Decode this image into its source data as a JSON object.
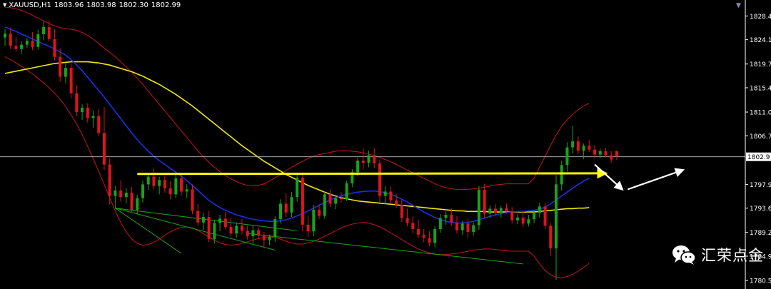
{
  "header": {
    "symbol_timeframe": "XAUUSD,H1",
    "open": "1803.96",
    "high": "1803.98",
    "low": "1802.30",
    "close": "1802.99"
  },
  "price_scale": {
    "labels": [
      "1828.4",
      "1824.1",
      "1819.7",
      "1815.4",
      "1811.0",
      "1806.7",
      "1802.9",
      "1797.9",
      "1793.6",
      "1789.2",
      "1784.9",
      "1780.5"
    ],
    "current_price_label": "1802.9",
    "current_price": 1802.9
  },
  "watermark": {
    "text": "汇荣点金",
    "icon": "wechat-icon"
  },
  "colors": {
    "background": "#000000",
    "bull_candle": "#19a319",
    "bear_candle": "#e0141b",
    "ma_fast": "#1432e6",
    "ma_slow": "#f0e614",
    "bollinger": "#c8141e",
    "trendline": "#1fa51f",
    "projection_arrow": "#ffff00",
    "forecast_arrow": "#ffffff",
    "price_line": "#c0c0c0"
  },
  "chart_data": {
    "type": "candlestick",
    "title": "XAUUSD,H1",
    "ylim": [
      1779.6,
      1830.0
    ],
    "candles": [
      {
        "o": 1824.5,
        "h": 1826.0,
        "l": 1823.0,
        "c": 1825.2
      },
      {
        "o": 1825.2,
        "h": 1826.3,
        "l": 1822.4,
        "c": 1823.0
      },
      {
        "o": 1823.0,
        "h": 1824.6,
        "l": 1821.9,
        "c": 1822.4
      },
      {
        "o": 1822.4,
        "h": 1823.8,
        "l": 1821.5,
        "c": 1823.2
      },
      {
        "o": 1823.2,
        "h": 1824.4,
        "l": 1822.6,
        "c": 1823.9
      },
      {
        "o": 1823.9,
        "h": 1825.5,
        "l": 1822.2,
        "c": 1822.8
      },
      {
        "o": 1822.8,
        "h": 1825.9,
        "l": 1822.3,
        "c": 1825.1
      },
      {
        "o": 1825.1,
        "h": 1827.4,
        "l": 1824.0,
        "c": 1826.4
      },
      {
        "o": 1826.4,
        "h": 1827.6,
        "l": 1823.8,
        "c": 1824.2
      },
      {
        "o": 1824.2,
        "h": 1826.0,
        "l": 1820.4,
        "c": 1821.0
      },
      {
        "o": 1821.0,
        "h": 1822.5,
        "l": 1816.5,
        "c": 1817.4
      },
      {
        "o": 1817.4,
        "h": 1819.8,
        "l": 1816.2,
        "c": 1819.0
      },
      {
        "o": 1819.0,
        "h": 1819.8,
        "l": 1813.5,
        "c": 1814.4
      },
      {
        "o": 1814.4,
        "h": 1815.9,
        "l": 1810.2,
        "c": 1811.0
      },
      {
        "o": 1811.0,
        "h": 1812.4,
        "l": 1809.6,
        "c": 1811.8
      },
      {
        "o": 1811.8,
        "h": 1812.6,
        "l": 1809.1,
        "c": 1809.9
      },
      {
        "o": 1809.9,
        "h": 1811.3,
        "l": 1808.1,
        "c": 1810.3
      },
      {
        "o": 1810.3,
        "h": 1811.5,
        "l": 1806.6,
        "c": 1807.2
      },
      {
        "o": 1807.2,
        "h": 1811.9,
        "l": 1800.5,
        "c": 1801.5
      },
      {
        "o": 1801.5,
        "h": 1802.6,
        "l": 1794.3,
        "c": 1795.8
      },
      {
        "o": 1795.8,
        "h": 1797.6,
        "l": 1793.6,
        "c": 1796.8
      },
      {
        "o": 1796.8,
        "h": 1798.6,
        "l": 1794.8,
        "c": 1795.6
      },
      {
        "o": 1795.6,
        "h": 1797.2,
        "l": 1794.5,
        "c": 1796.4
      },
      {
        "o": 1796.4,
        "h": 1797.4,
        "l": 1792.7,
        "c": 1793.3
      },
      {
        "o": 1793.3,
        "h": 1796.0,
        "l": 1792.6,
        "c": 1795.4
      },
      {
        "o": 1795.4,
        "h": 1798.6,
        "l": 1794.6,
        "c": 1797.9
      },
      {
        "o": 1797.9,
        "h": 1800.0,
        "l": 1796.9,
        "c": 1799.3
      },
      {
        "o": 1799.3,
        "h": 1800.8,
        "l": 1797.0,
        "c": 1797.6
      },
      {
        "o": 1797.6,
        "h": 1799.3,
        "l": 1796.1,
        "c": 1798.7
      },
      {
        "o": 1798.7,
        "h": 1799.4,
        "l": 1796.4,
        "c": 1797.2
      },
      {
        "o": 1797.2,
        "h": 1798.5,
        "l": 1795.2,
        "c": 1796.1
      },
      {
        "o": 1796.1,
        "h": 1799.8,
        "l": 1795.4,
        "c": 1799.0
      },
      {
        "o": 1799.0,
        "h": 1799.9,
        "l": 1795.9,
        "c": 1796.6
      },
      {
        "o": 1796.6,
        "h": 1797.9,
        "l": 1795.4,
        "c": 1797.0
      },
      {
        "o": 1797.0,
        "h": 1797.9,
        "l": 1792.5,
        "c": 1793.1
      },
      {
        "o": 1793.1,
        "h": 1794.3,
        "l": 1790.4,
        "c": 1791.0
      },
      {
        "o": 1791.0,
        "h": 1792.8,
        "l": 1789.6,
        "c": 1792.0
      },
      {
        "o": 1792.0,
        "h": 1793.1,
        "l": 1787.4,
        "c": 1788.0
      },
      {
        "o": 1788.0,
        "h": 1791.5,
        "l": 1787.2,
        "c": 1790.9
      },
      {
        "o": 1790.9,
        "h": 1792.4,
        "l": 1789.4,
        "c": 1791.7
      },
      {
        "o": 1791.7,
        "h": 1792.9,
        "l": 1789.8,
        "c": 1790.2
      },
      {
        "o": 1790.2,
        "h": 1791.8,
        "l": 1788.4,
        "c": 1789.0
      },
      {
        "o": 1789.0,
        "h": 1791.0,
        "l": 1788.2,
        "c": 1790.4
      },
      {
        "o": 1790.4,
        "h": 1791.6,
        "l": 1788.8,
        "c": 1789.5
      },
      {
        "o": 1789.5,
        "h": 1790.4,
        "l": 1787.9,
        "c": 1788.5
      },
      {
        "o": 1788.5,
        "h": 1790.4,
        "l": 1787.2,
        "c": 1789.6
      },
      {
        "o": 1789.6,
        "h": 1790.2,
        "l": 1788.0,
        "c": 1788.6
      },
      {
        "o": 1788.6,
        "h": 1789.3,
        "l": 1786.4,
        "c": 1787.8
      },
      {
        "o": 1787.8,
        "h": 1788.8,
        "l": 1786.9,
        "c": 1788.4
      },
      {
        "o": 1788.4,
        "h": 1792.1,
        "l": 1787.5,
        "c": 1791.6
      },
      {
        "o": 1791.6,
        "h": 1795.2,
        "l": 1790.8,
        "c": 1794.4
      },
      {
        "o": 1794.4,
        "h": 1796.3,
        "l": 1792.0,
        "c": 1792.8
      },
      {
        "o": 1792.8,
        "h": 1796.5,
        "l": 1792.0,
        "c": 1795.6
      },
      {
        "o": 1795.6,
        "h": 1799.9,
        "l": 1794.8,
        "c": 1799.1
      },
      {
        "o": 1799.1,
        "h": 1800.1,
        "l": 1789.4,
        "c": 1790.6
      },
      {
        "o": 1790.6,
        "h": 1792.2,
        "l": 1788.4,
        "c": 1789.4
      },
      {
        "o": 1789.4,
        "h": 1794.2,
        "l": 1788.5,
        "c": 1793.3
      },
      {
        "o": 1793.3,
        "h": 1794.3,
        "l": 1791.6,
        "c": 1792.2
      },
      {
        "o": 1792.2,
        "h": 1796.6,
        "l": 1791.7,
        "c": 1796.1
      },
      {
        "o": 1796.1,
        "h": 1797.0,
        "l": 1793.8,
        "c": 1794.4
      },
      {
        "o": 1794.4,
        "h": 1796.0,
        "l": 1793.4,
        "c": 1795.4
      },
      {
        "o": 1795.4,
        "h": 1796.5,
        "l": 1794.6,
        "c": 1795.2
      },
      {
        "o": 1795.2,
        "h": 1798.6,
        "l": 1794.9,
        "c": 1798.1
      },
      {
        "o": 1798.1,
        "h": 1800.7,
        "l": 1797.4,
        "c": 1800.1
      },
      {
        "o": 1800.1,
        "h": 1802.7,
        "l": 1799.4,
        "c": 1802.2
      },
      {
        "o": 1802.2,
        "h": 1804.4,
        "l": 1800.6,
        "c": 1801.8
      },
      {
        "o": 1801.8,
        "h": 1804.0,
        "l": 1801.0,
        "c": 1803.2
      },
      {
        "o": 1803.2,
        "h": 1804.5,
        "l": 1800.8,
        "c": 1801.7
      },
      {
        "o": 1801.7,
        "h": 1802.4,
        "l": 1794.7,
        "c": 1795.8
      },
      {
        "o": 1795.8,
        "h": 1797.6,
        "l": 1794.4,
        "c": 1796.6
      },
      {
        "o": 1796.6,
        "h": 1797.5,
        "l": 1794.3,
        "c": 1795.0
      },
      {
        "o": 1795.0,
        "h": 1796.2,
        "l": 1793.6,
        "c": 1794.2
      },
      {
        "o": 1794.2,
        "h": 1795.3,
        "l": 1791.1,
        "c": 1791.8
      },
      {
        "o": 1791.8,
        "h": 1793.5,
        "l": 1790.3,
        "c": 1790.9
      },
      {
        "o": 1790.9,
        "h": 1792.1,
        "l": 1789.0,
        "c": 1789.8
      },
      {
        "o": 1789.8,
        "h": 1791.5,
        "l": 1788.2,
        "c": 1788.8
      },
      {
        "o": 1788.8,
        "h": 1789.8,
        "l": 1787.4,
        "c": 1788.2
      },
      {
        "o": 1788.2,
        "h": 1789.4,
        "l": 1786.7,
        "c": 1787.3
      },
      {
        "o": 1787.3,
        "h": 1790.3,
        "l": 1786.5,
        "c": 1789.8
      },
      {
        "o": 1789.8,
        "h": 1792.5,
        "l": 1789.1,
        "c": 1791.8
      },
      {
        "o": 1791.8,
        "h": 1793.0,
        "l": 1790.6,
        "c": 1792.4
      },
      {
        "o": 1792.4,
        "h": 1793.6,
        "l": 1790.4,
        "c": 1791.0
      },
      {
        "o": 1791.0,
        "h": 1792.2,
        "l": 1789.0,
        "c": 1789.6
      },
      {
        "o": 1789.6,
        "h": 1791.3,
        "l": 1788.7,
        "c": 1790.8
      },
      {
        "o": 1790.8,
        "h": 1791.7,
        "l": 1788.2,
        "c": 1789.3
      },
      {
        "o": 1789.3,
        "h": 1791.0,
        "l": 1788.6,
        "c": 1790.5
      },
      {
        "o": 1790.5,
        "h": 1797.6,
        "l": 1789.7,
        "c": 1796.9
      },
      {
        "o": 1796.9,
        "h": 1798.0,
        "l": 1791.8,
        "c": 1792.6
      },
      {
        "o": 1792.6,
        "h": 1794.1,
        "l": 1791.9,
        "c": 1793.5
      },
      {
        "o": 1793.5,
        "h": 1794.3,
        "l": 1792.2,
        "c": 1792.8
      },
      {
        "o": 1792.8,
        "h": 1794.0,
        "l": 1791.9,
        "c": 1793.6
      },
      {
        "o": 1793.6,
        "h": 1794.4,
        "l": 1792.6,
        "c": 1793.0
      },
      {
        "o": 1793.0,
        "h": 1793.8,
        "l": 1790.8,
        "c": 1791.4
      },
      {
        "o": 1791.4,
        "h": 1792.5,
        "l": 1790.7,
        "c": 1791.9
      },
      {
        "o": 1791.9,
        "h": 1793.1,
        "l": 1790.2,
        "c": 1790.8
      },
      {
        "o": 1790.8,
        "h": 1792.4,
        "l": 1790.3,
        "c": 1791.6
      },
      {
        "o": 1791.6,
        "h": 1793.3,
        "l": 1790.9,
        "c": 1792.7
      },
      {
        "o": 1792.7,
        "h": 1794.6,
        "l": 1791.9,
        "c": 1793.9
      },
      {
        "o": 1793.9,
        "h": 1794.5,
        "l": 1789.8,
        "c": 1790.4
      },
      {
        "o": 1790.4,
        "h": 1790.9,
        "l": 1785.0,
        "c": 1786.3
      },
      {
        "o": 1786.3,
        "h": 1799.6,
        "l": 1780.6,
        "c": 1797.9
      },
      {
        "o": 1797.9,
        "h": 1802.2,
        "l": 1796.8,
        "c": 1801.4
      },
      {
        "o": 1801.4,
        "h": 1805.5,
        "l": 1800.2,
        "c": 1804.6
      },
      {
        "o": 1804.6,
        "h": 1808.5,
        "l": 1803.5,
        "c": 1805.7
      },
      {
        "o": 1805.7,
        "h": 1806.6,
        "l": 1803.4,
        "c": 1804.0
      },
      {
        "o": 1804.0,
        "h": 1805.3,
        "l": 1802.5,
        "c": 1804.9
      },
      {
        "o": 1804.9,
        "h": 1805.9,
        "l": 1803.8,
        "c": 1804.2
      },
      {
        "o": 1804.2,
        "h": 1805.0,
        "l": 1802.6,
        "c": 1803.3
      },
      {
        "o": 1803.3,
        "h": 1804.4,
        "l": 1802.7,
        "c": 1803.9
      },
      {
        "o": 1803.9,
        "h": 1804.5,
        "l": 1802.8,
        "c": 1803.2
      },
      {
        "o": 1803.2,
        "h": 1803.9,
        "l": 1801.8,
        "c": 1802.4
      },
      {
        "o": 1803.96,
        "h": 1803.98,
        "l": 1802.3,
        "c": 1802.99
      }
    ],
    "ma_fast": [
      1826.4,
      1826.0,
      1825.6,
      1825.1,
      1824.7,
      1824.2,
      1823.8,
      1823.3,
      1822.9,
      1822.4,
      1821.9,
      1821.3,
      1820.5,
      1819.5,
      1818.5,
      1817.3,
      1816.1,
      1814.9,
      1813.7,
      1812.4,
      1811.1,
      1809.8,
      1808.5,
      1807.2,
      1806.0,
      1804.9,
      1803.9,
      1803.0,
      1802.2,
      1801.5,
      1800.8,
      1800.1,
      1799.4,
      1798.6,
      1797.7,
      1796.8,
      1795.9,
      1795.0,
      1794.3,
      1793.7,
      1793.2,
      1792.8,
      1792.4,
      1792.1,
      1791.8,
      1791.6,
      1791.4,
      1791.3,
      1791.2,
      1791.2,
      1791.3,
      1791.5,
      1791.8,
      1792.2,
      1792.6,
      1793.1,
      1793.6,
      1794.1,
      1794.6,
      1795.1,
      1795.5,
      1795.8,
      1796.1,
      1796.3,
      1796.5,
      1796.6,
      1796.7,
      1796.7,
      1796.6,
      1796.4,
      1796.1,
      1795.7,
      1795.2,
      1794.7,
      1794.1,
      1793.5,
      1792.9,
      1792.4,
      1791.9,
      1791.5,
      1791.2,
      1791.0,
      1790.9,
      1790.9,
      1791.0,
      1791.2,
      1791.5,
      1791.8,
      1792.1,
      1792.4,
      1792.6,
      1792.8,
      1792.9,
      1793.0,
      1793.0,
      1793.1,
      1793.2,
      1793.4,
      1793.8,
      1794.4,
      1795.1,
      1795.8,
      1796.5,
      1797.2,
      1797.9,
      1798.5,
      1799.0
    ],
    "ma_slow": [
      1818.0,
      1818.2,
      1818.4,
      1818.6,
      1818.8,
      1819.0,
      1819.2,
      1819.4,
      1819.6,
      1819.8,
      1819.9,
      1820.0,
      1820.1,
      1820.1,
      1820.1,
      1820.1,
      1820.0,
      1819.9,
      1819.7,
      1819.5,
      1819.2,
      1818.9,
      1818.6,
      1818.3,
      1817.9,
      1817.5,
      1817.0,
      1816.5,
      1816.0,
      1815.4,
      1814.8,
      1814.2,
      1813.5,
      1812.8,
      1812.1,
      1811.3,
      1810.5,
      1809.7,
      1808.9,
      1808.1,
      1807.3,
      1806.5,
      1805.7,
      1804.9,
      1804.2,
      1803.5,
      1802.8,
      1802.1,
      1801.5,
      1800.9,
      1800.3,
      1799.7,
      1799.2,
      1798.7,
      1798.2,
      1797.7,
      1797.3,
      1796.9,
      1796.5,
      1796.1,
      1795.8,
      1795.5,
      1795.3,
      1795.1,
      1794.9,
      1794.8,
      1794.7,
      1794.6,
      1794.5,
      1794.4,
      1794.3,
      1794.2,
      1794.1,
      1794.0,
      1793.9,
      1793.8,
      1793.7,
      1793.6,
      1793.5,
      1793.4,
      1793.3,
      1793.2,
      1793.1,
      1793.1,
      1793.0,
      1793.0,
      1793.0,
      1793.0,
      1792.9,
      1792.9,
      1792.9,
      1792.9,
      1792.9,
      1792.9,
      1792.9,
      1792.9,
      1792.9,
      1793.0,
      1793.1,
      1793.2,
      1793.3,
      1793.4,
      1793.5,
      1793.5,
      1793.6,
      1793.6,
      1793.7
    ],
    "bb_upper": [
      1830.0,
      1829.9,
      1829.7,
      1829.4,
      1829.0,
      1828.5,
      1828.0,
      1827.5,
      1827.0,
      1826.6,
      1826.3,
      1826.1,
      1826.0,
      1825.8,
      1825.4,
      1824.9,
      1824.2,
      1823.4,
      1822.6,
      1821.8,
      1821.0,
      1820.1,
      1819.2,
      1818.2,
      1817.1,
      1816.0,
      1814.8,
      1813.6,
      1812.4,
      1811.2,
      1810.0,
      1808.8,
      1807.6,
      1806.4,
      1805.2,
      1804.0,
      1802.9,
      1801.9,
      1801.0,
      1800.2,
      1799.5,
      1798.9,
      1798.4,
      1798.0,
      1797.7,
      1797.6,
      1797.7,
      1798.0,
      1798.5,
      1799.1,
      1799.7,
      1800.4,
      1801.0,
      1801.6,
      1802.1,
      1802.6,
      1803.0,
      1803.3,
      1803.5,
      1803.7,
      1803.9,
      1804.0,
      1804.0,
      1803.9,
      1803.8,
      1803.6,
      1803.4,
      1803.1,
      1802.8,
      1802.4,
      1802.0,
      1801.5,
      1801.0,
      1800.5,
      1800.0,
      1799.5,
      1799.0,
      1798.5,
      1798.0,
      1797.6,
      1797.3,
      1797.1,
      1797.0,
      1797.0,
      1797.0,
      1797.1,
      1797.2,
      1797.4,
      1797.6,
      1797.8,
      1797.9,
      1798.0,
      1798.0,
      1798.0,
      1798.0,
      1798.0,
      1799.0,
      1801.0,
      1803.0,
      1805.0,
      1806.8,
      1808.4,
      1809.6,
      1810.6,
      1811.4,
      1812.1,
      1812.6
    ],
    "bb_lower": [
      1821.0,
      1820.5,
      1819.9,
      1819.3,
      1818.6,
      1817.9,
      1817.1,
      1816.3,
      1815.4,
      1814.4,
      1813.3,
      1812.0,
      1810.5,
      1808.8,
      1806.9,
      1804.8,
      1802.6,
      1800.3,
      1797.9,
      1795.5,
      1793.1,
      1791.0,
      1789.3,
      1788.0,
      1787.2,
      1786.9,
      1787.0,
      1787.4,
      1788.0,
      1788.7,
      1789.3,
      1789.8,
      1790.1,
      1790.2,
      1790.0,
      1789.6,
      1789.0,
      1788.4,
      1787.8,
      1787.3,
      1787.0,
      1786.9,
      1787.0,
      1787.2,
      1787.5,
      1787.8,
      1788.1,
      1788.3,
      1788.4,
      1788.3,
      1788.0,
      1787.6,
      1787.3,
      1787.1,
      1787.1,
      1787.3,
      1787.6,
      1788.0,
      1788.5,
      1789.0,
      1789.5,
      1790.0,
      1790.4,
      1790.7,
      1790.9,
      1791.0,
      1790.9,
      1790.6,
      1790.2,
      1789.7,
      1789.1,
      1788.5,
      1787.9,
      1787.3,
      1786.7,
      1786.2,
      1785.8,
      1785.5,
      1785.3,
      1785.2,
      1785.2,
      1785.3,
      1785.4,
      1785.6,
      1785.8,
      1786.0,
      1786.1,
      1786.2,
      1786.2,
      1786.1,
      1786.0,
      1785.9,
      1785.8,
      1785.8,
      1785.8,
      1785.8,
      1784.9,
      1783.5,
      1782.3,
      1781.5,
      1781.1,
      1781.0,
      1781.2,
      1781.6,
      1782.2,
      1782.9,
      1783.6
    ],
    "trendlines": [
      {
        "from": [
          20,
          1793.6
        ],
        "to": [
          53,
          1789.5
        ]
      },
      {
        "from": [
          20,
          1793.6
        ],
        "to": [
          32,
          1785.4
        ]
      },
      {
        "from": [
          20,
          1793.6
        ],
        "to": [
          49,
          1786.0
        ]
      },
      {
        "from": [
          44,
          1789.0
        ],
        "to": [
          94,
          1783.5
        ]
      }
    ],
    "horizontal_arrow": {
      "from": [
        24,
        1799.8
      ],
      "to": [
        109,
        1799.9
      ]
    },
    "forecast_down": {
      "from": [
        107,
        1801.5
      ],
      "to": [
        112,
        1797.0
      ]
    },
    "forecast_up": {
      "from": [
        113,
        1797.0
      ],
      "to": [
        123,
        1800.5
      ]
    }
  }
}
